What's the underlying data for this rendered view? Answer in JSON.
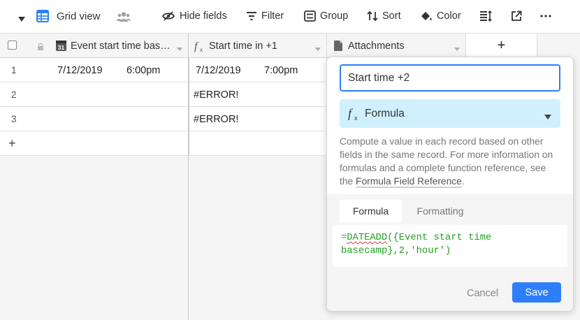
{
  "toolbar": {
    "view_name": "Grid view",
    "hide_fields": "Hide fields",
    "filter": "Filter",
    "group": "Group",
    "sort": "Sort",
    "color": "Color"
  },
  "grid": {
    "columns": [
      {
        "name": "Event start time bas…",
        "icon": "calendar-icon",
        "icon_text": "31"
      },
      {
        "name": "Start time in +1",
        "icon": "formula-icon"
      },
      {
        "name": "Attachments",
        "icon": "attachment-icon"
      }
    ],
    "add_field": "+",
    "rows": [
      {
        "num": "1",
        "c1_date": "7/12/2019",
        "c1_time": "6:00pm",
        "c2_date": "7/12/2019",
        "c2_time": "7:00pm",
        "c2_error": ""
      },
      {
        "num": "2",
        "c1_date": "",
        "c1_time": "",
        "c2_date": "",
        "c2_time": "",
        "c2_error": "#ERROR!"
      },
      {
        "num": "3",
        "c1_date": "",
        "c1_time": "",
        "c2_date": "",
        "c2_time": "",
        "c2_error": "#ERROR!"
      }
    ],
    "add_row": "+"
  },
  "field_editor": {
    "name_value": "Start time +2",
    "type_label": "Formula",
    "description": "Compute a value in each record based on other fields in the same record. For more information on formulas and a complete function reference, see the ",
    "reference_link": "Formula Field Reference",
    "description_end": ".",
    "tabs": [
      "Formula",
      "Formatting"
    ],
    "formula_fn": "DATEADD",
    "formula_prefix": "=",
    "formula_rest_line1": "({Event start time",
    "formula_line2": "basecamp},2,'hour')",
    "cancel": "Cancel",
    "save": "Save"
  },
  "colors": {
    "accent": "#2d7ff9",
    "type_bg": "#d0f0fd",
    "formula_text": "#20a020"
  }
}
